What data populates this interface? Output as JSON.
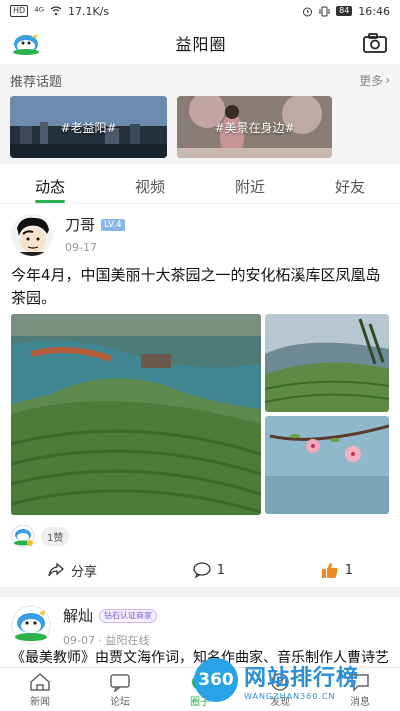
{
  "status_bar": {
    "network_badge": "HD",
    "signal": "⁴ᴳ",
    "speed": "17.1K/s",
    "battery": "84",
    "time": "16:46"
  },
  "header": {
    "title": "益阳圈"
  },
  "topics": {
    "heading": "推荐话题",
    "more_label": "更多",
    "items": [
      {
        "label": "#老益阳#"
      },
      {
        "label": "#美景在身边#"
      }
    ]
  },
  "tabs": [
    {
      "label": "动态",
      "active": true
    },
    {
      "label": "视频",
      "active": false
    },
    {
      "label": "附近",
      "active": false
    },
    {
      "label": "好友",
      "active": false
    }
  ],
  "post1": {
    "username": "刀哥",
    "level": "LV.4",
    "time": "09-17",
    "text": "今年4月，中国美丽十大茶园之一的安化柘溪库区凤凰岛茶园。",
    "likes_label": "1赞",
    "share_label": "分享",
    "comment_count": "1",
    "like_count": "1"
  },
  "post2": {
    "username": "解灿",
    "badge": "钻石认证商家",
    "time": "09-07 · 益阳在线",
    "text": "《最美教师》由贾文海作词，知名作曲家、音乐制作人曹诗艺作曲，七。。。"
  },
  "bottom_nav": [
    {
      "label": "新闻",
      "icon": "home-icon"
    },
    {
      "label": "论坛",
      "icon": "forum-icon"
    },
    {
      "label": "圈子",
      "icon": "circle-icon",
      "active": true
    },
    {
      "label": "发现",
      "icon": "discover-icon"
    },
    {
      "label": "消息",
      "icon": "message-icon"
    }
  ],
  "watermark": {
    "circle": "360",
    "main": "网站排行榜",
    "sub": "WANGZHAN360.CN"
  },
  "colors": {
    "accent": "#2bb24c",
    "watermark": "#2a8fd8"
  }
}
